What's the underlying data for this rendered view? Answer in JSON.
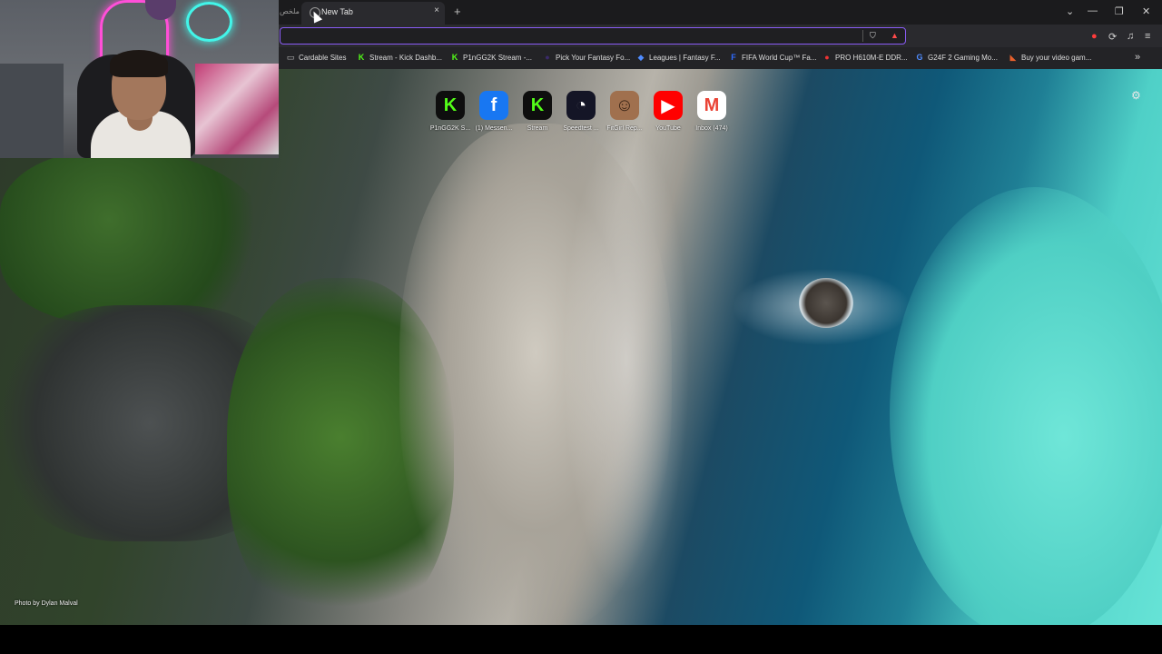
{
  "browser": {
    "tab_title": "New Tab",
    "tab_left_text": "ملخص",
    "new_tab_symbol": "+",
    "close_symbol": "×",
    "omnibox_value": "",
    "window_controls": [
      "⌄",
      "—",
      "❐",
      "✕"
    ],
    "toolbar_icons": [
      "brave-shield-icon",
      "brave-rewards-icon",
      "extensions-icon",
      "puzzle-icon",
      "music-icon",
      "menu-icon"
    ]
  },
  "bookmarks": [
    {
      "label": "Cardable Sites",
      "icon": "folder-icon",
      "glyph": "▭",
      "color": "#bdbdbd"
    },
    {
      "label": "Stream - Kick Dashb...",
      "icon": "kick-icon",
      "glyph": "K",
      "color": "#53fc18"
    },
    {
      "label": "P1nGG2K Stream -...",
      "icon": "kick-icon",
      "glyph": "K",
      "color": "#53fc18"
    },
    {
      "label": "Pick Your Fantasy Fo...",
      "icon": "fantasy-icon",
      "glyph": "●",
      "color": "#3b2a6b"
    },
    {
      "label": "Leagues | Fantasy F...",
      "icon": "leagues-icon",
      "glyph": "◆",
      "color": "#4f8cff"
    },
    {
      "label": "FIFA World Cup™ Fa...",
      "icon": "fifa-icon",
      "glyph": "F",
      "color": "#2f6bff"
    },
    {
      "label": "PRO H610M-E DDR...",
      "icon": "asus-icon",
      "glyph": "●",
      "color": "#e33"
    },
    {
      "label": "G24F 2 Gaming Mo...",
      "icon": "google-icon",
      "glyph": "G",
      "color": "#4f8cff"
    },
    {
      "label": "Buy your video gam...",
      "icon": "store-icon",
      "glyph": "◣",
      "color": "#e8602c"
    }
  ],
  "bookmarks_more": "»",
  "top_sites": [
    {
      "label": "P1nGG2K S...",
      "glyph": "K",
      "bg": "#0e0e0e",
      "fg": "#53fc18",
      "icon": "kick-icon"
    },
    {
      "label": "(1) Messen...",
      "glyph": "f",
      "bg": "#1877f2",
      "fg": "#ffffff",
      "icon": "facebook-icon"
    },
    {
      "label": "Stream",
      "glyph": "K",
      "bg": "#0e0e0e",
      "fg": "#53fc18",
      "icon": "kick-icon"
    },
    {
      "label": "Speedtest ...",
      "glyph": "◔",
      "bg": "#141526",
      "fg": "#ffffff",
      "icon": "speedtest-icon"
    },
    {
      "label": "FitGirl Rep...",
      "glyph": "☺",
      "bg": "#a0704e",
      "fg": "#3a2416",
      "icon": "fitgirl-icon"
    },
    {
      "label": "YouTube",
      "glyph": "▶",
      "bg": "#ff0000",
      "fg": "#ffffff",
      "icon": "youtube-icon"
    },
    {
      "label": "Inbox (474)",
      "glyph": "M",
      "bg": "#ffffff",
      "fg": "#ea4335",
      "icon": "gmail-icon"
    }
  ],
  "photo_credit": "Photo by Dylan Malval"
}
